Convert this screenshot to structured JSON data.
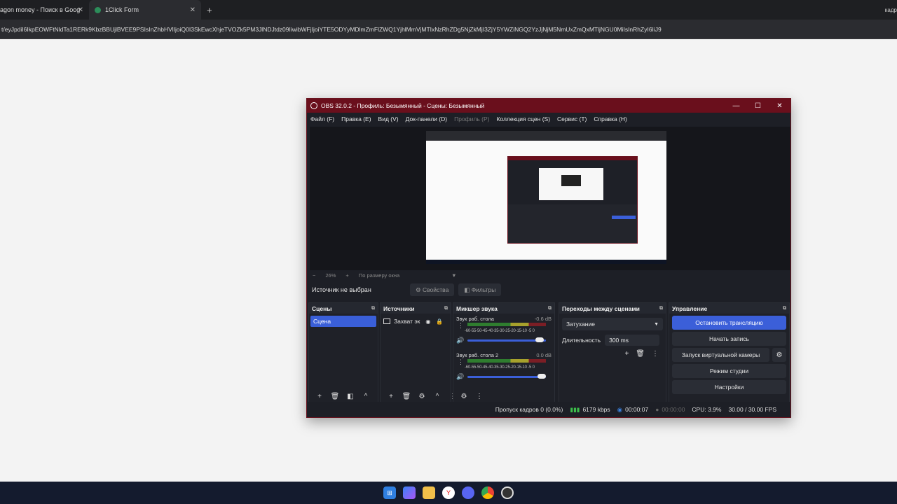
{
  "browser": {
    "tab1_title": "agon money - Поиск в Goog",
    "tab2_title": "1Click Form",
    "close_glyph": "✕",
    "newtab_glyph": "+",
    "right_text": "кадр",
    "url": "t/eyJpdiI6IkpEOWFtNldTa1RERk9KbzBBUjlBVEE9PSIsInZhbHVlIjoiQ0I3SkEwcXhjeTVOZk5PM3JlNDJtdz09IiwibWFjIjoiYTE5ODYyMDlmZmFlZWQ1YjhlMmVjMTIxNzRhZDg5NjZkMjI3ZjY5YWZiNGQ2YzJjNjM5NmUxZmQxMTljNGU0MiIsInRhZyI6IiJ9"
  },
  "obs": {
    "title": "OBS 32.0.2 - Профиль: Безымянный - Сцены: Безымянный",
    "win_min": "—",
    "win_max": "☐",
    "win_close": "✕",
    "menu": [
      "Файл (F)",
      "Правка (E)",
      "Вид (V)",
      "Док-панели (D)",
      "Профиль (P)",
      "Коллекция сцен (S)",
      "Сервис (T)",
      "Справка (H)"
    ],
    "zoom": {
      "minus": "−",
      "value": "26%",
      "plus": "+",
      "fit": "По размеру окна",
      "arrow": "▼"
    },
    "source_bar": {
      "label": "Источник не выбран",
      "properties": "Свойства",
      "filters": "Фильтры"
    },
    "docks": {
      "scenes": {
        "title": "Сцены",
        "items": [
          "Сцена"
        ]
      },
      "sources": {
        "title": "Источники",
        "items": [
          "Захват эк"
        ]
      },
      "mixer": {
        "title": "Микшер звука",
        "channels": [
          {
            "name": "Звук раб. стола",
            "db": "-0.6 dB",
            "level": 0.97
          },
          {
            "name": "Звук раб. стола 2",
            "db": "0.0 dB",
            "level": 1.0
          }
        ],
        "ticks": "-60-55-50-45-40-35-30-25-20-15-10 -5 0"
      },
      "transitions": {
        "title": "Переходы между сценами",
        "selected": "Затухание",
        "duration_label": "Длительность",
        "duration": "300 ms"
      },
      "controls": {
        "title": "Управление",
        "stop_stream": "Остановить трансляцию",
        "start_record": "Начать запись",
        "virtual_cam": "Запуск виртуальной камеры",
        "studio_mode": "Режим студии",
        "settings": "Настройки"
      }
    },
    "status": {
      "dropped": "Пропуск кадров 0 (0.0%)",
      "bitrate": "6179 kbps",
      "stream_time": "00:00:07",
      "rec_time": "00:00:00",
      "cpu": "CPU: 3.9%",
      "fps": "30.00 / 30.00 FPS"
    },
    "colors": {
      "accent": "#3b5fd9",
      "titlebar": "#6a0f1c"
    }
  },
  "taskbar": {
    "icons": [
      "windows-start-icon",
      "copilot-icon",
      "explorer-icon",
      "yandex-icon",
      "discord-icon",
      "chrome-icon",
      "obs-icon"
    ]
  }
}
